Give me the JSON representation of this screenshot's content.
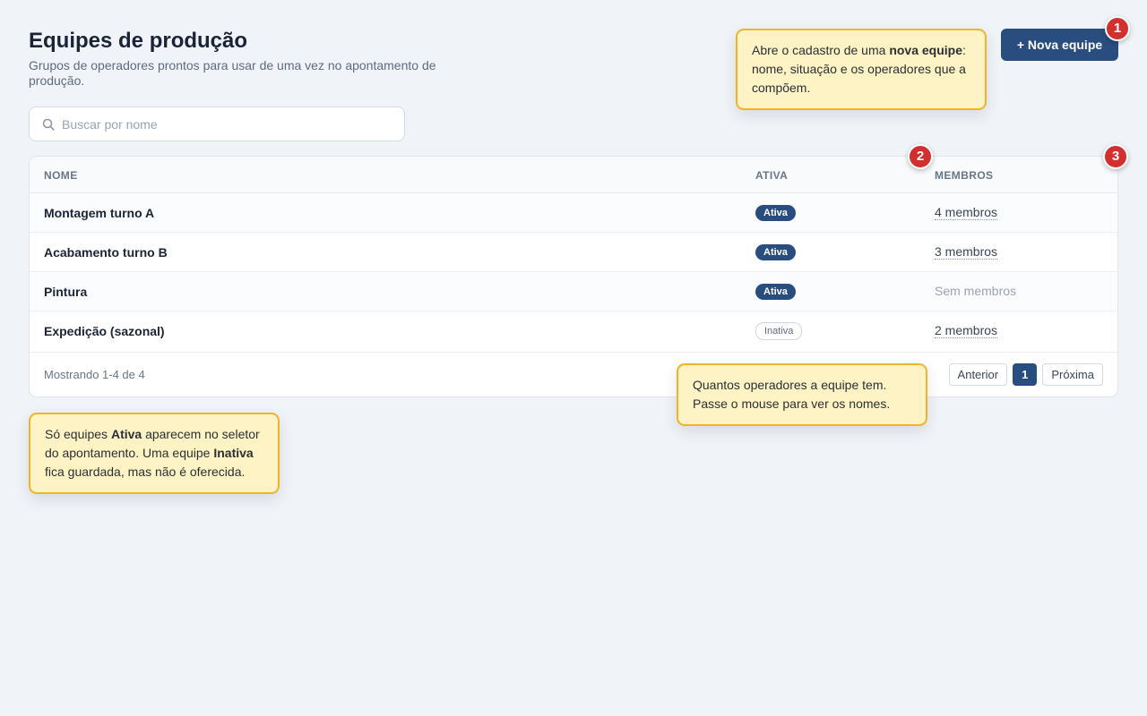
{
  "header": {
    "title": "Equipes de produção",
    "subtitle": "Grupos de operadores prontos para usar de uma vez no apontamento de produção.",
    "new_button_label": "+ Nova equipe"
  },
  "search": {
    "placeholder": "Buscar por nome",
    "value": ""
  },
  "table": {
    "columns": {
      "name": "NOME",
      "active": "ATIVA",
      "members": "MEMBROS"
    },
    "rows": [
      {
        "name": "Montagem turno A",
        "status": "Ativa",
        "members": "4 membros"
      },
      {
        "name": "Acabamento turno B",
        "status": "Ativa",
        "members": "3 membros"
      },
      {
        "name": "Pintura",
        "status": "Ativa",
        "members": "Sem membros"
      },
      {
        "name": "Expedição (sazonal)",
        "status": "Inativa",
        "members": "2 membros"
      }
    ]
  },
  "pagination": {
    "showing": "Mostrando 1-4 de 4",
    "prev_label": "Anterior",
    "current_page": "1",
    "next_label": "Próxima"
  },
  "annotations": {
    "markers": [
      "1",
      "2",
      "3"
    ],
    "tip_new_team": {
      "t1": "Abre o cadastro de uma ",
      "b1": "nova equipe",
      "t2": ": nome, situação e os operadores que a compõem."
    },
    "tip_members": {
      "t1": "Quantos operadores a equipe tem. Passe o mouse para ver os nomes."
    },
    "tip_status": {
      "t1": "Só equipes ",
      "b1": "Ativa",
      "t2": " aparecem no seletor do apontamento. Uma equipe ",
      "b2": "Inativa",
      "t3": " fica guardada, mas não é oferecida."
    }
  },
  "colors": {
    "primary": "#2a4d80",
    "tip_background": "#fef3c4",
    "tip_border": "#f0b429",
    "marker": "#d32f2f"
  },
  "icons": {
    "search": "search-icon"
  }
}
